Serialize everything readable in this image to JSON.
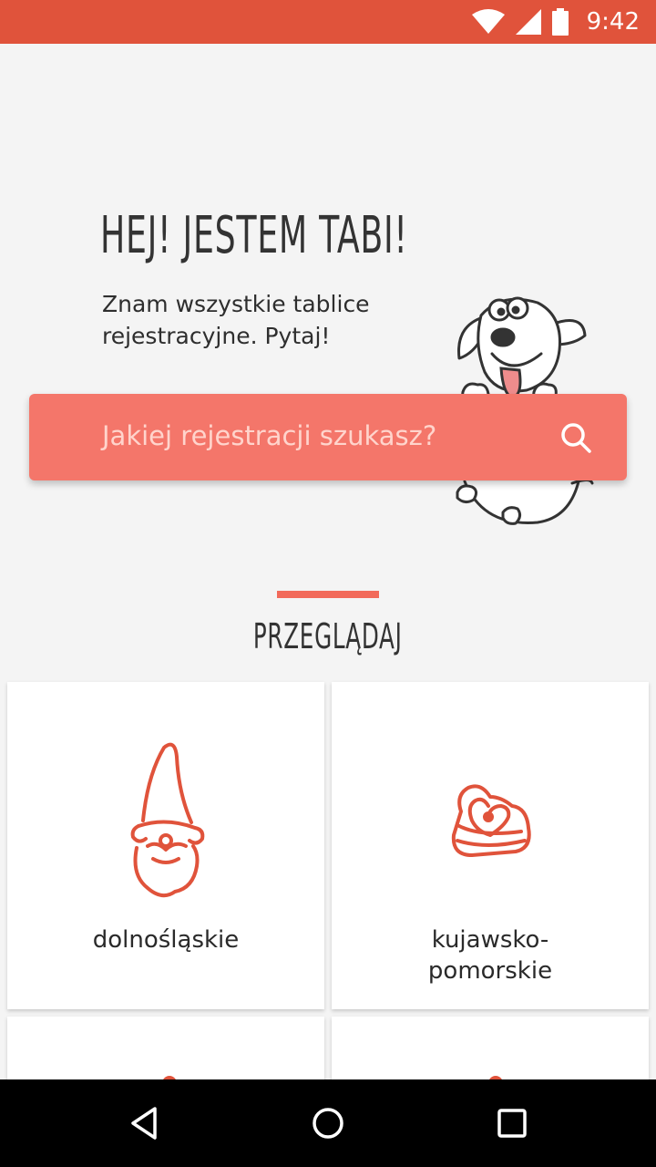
{
  "status_bar": {
    "time": "9:42",
    "color": "#e0533b"
  },
  "hero": {
    "title": "HEJ! JESTEM TABI!",
    "subtitle": "Znam wszystkie tablice rejestracyjne. Pytaj!"
  },
  "search": {
    "placeholder": "Jakiej rejestracji szukasz?",
    "icon": "search-icon",
    "color": "#f4766a"
  },
  "browse": {
    "title": "PRZEGLĄDAJ",
    "accent": "#f26a5a"
  },
  "regions": [
    {
      "label": "dolnośląskie",
      "icon": "gnome-icon"
    },
    {
      "label": "kujawsko-\npomorskie",
      "icon": "heart-gingerbread-icon"
    }
  ],
  "nav": {
    "back": "back-icon",
    "home": "home-icon",
    "recents": "recents-icon"
  }
}
